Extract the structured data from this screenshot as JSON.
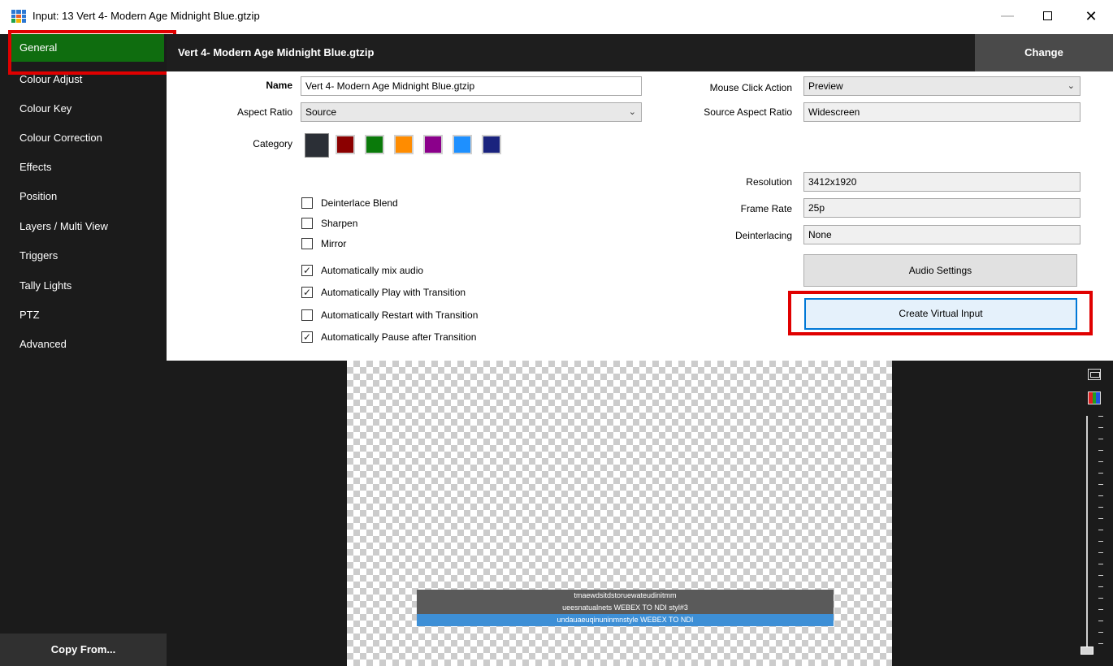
{
  "window": {
    "title": "Input: 13 Vert 4- Modern Age Midnight Blue.gtzip",
    "minimize_label": "—",
    "close_label": "✕",
    "app_icon_colors": [
      "#2c78d3",
      "#2c78d3",
      "#2c78d3",
      "#2c78d3",
      "#e85d2a",
      "#2c78d3",
      "#1fa24a",
      "#f0b400",
      "#2c78d3"
    ]
  },
  "sidebar": {
    "items": [
      {
        "label": "General",
        "active": true
      },
      {
        "label": "Colour Adjust"
      },
      {
        "label": "Colour Key"
      },
      {
        "label": "Colour Correction"
      },
      {
        "label": "Effects"
      },
      {
        "label": "Position"
      },
      {
        "label": "Layers / Multi View"
      },
      {
        "label": "Triggers"
      },
      {
        "label": "Tally Lights"
      },
      {
        "label": "PTZ"
      },
      {
        "label": "Advanced"
      }
    ],
    "copy_from_label": "Copy From..."
  },
  "header": {
    "input_name": "Vert 4- Modern Age Midnight Blue.gtzip",
    "change_label": "Change"
  },
  "form": {
    "name_label": "Name",
    "name_value": "Vert 4- Modern Age Midnight Blue.gtzip",
    "aspect_ratio_label": "Aspect Ratio",
    "aspect_ratio_value": "Source",
    "category_label": "Category",
    "category_colors": [
      "#2b2f36",
      "#8b0000",
      "#0a7a0a",
      "#ff8c00",
      "#8b008b",
      "#1e90ff",
      "#1a237e"
    ],
    "mouse_click_label": "Mouse Click Action",
    "mouse_click_value": "Preview",
    "source_aspect_label": "Source Aspect Ratio",
    "source_aspect_value": "Widescreen",
    "resolution_label": "Resolution",
    "resolution_value": "3412x1920",
    "frame_rate_label": "Frame Rate",
    "frame_rate_value": "25p",
    "deinterlacing_label": "Deinterlacing",
    "deinterlacing_value": "None",
    "audio_settings_label": "Audio Settings",
    "create_virtual_label": "Create Virtual Input",
    "checkboxes": [
      {
        "label": "Deinterlace Blend",
        "checked": false
      },
      {
        "label": "Sharpen",
        "checked": false
      },
      {
        "label": "Mirror",
        "checked": false
      },
      {
        "label": "Automatically mix audio",
        "checked": true
      },
      {
        "label": "Automatically Play with Transition",
        "checked": true
      },
      {
        "label": "Automatically Restart with Transition",
        "checked": false
      },
      {
        "label": "Automatically Pause after Transition",
        "checked": true
      }
    ]
  },
  "preview": {
    "lower_third": [
      "tmaewdsitdstoruewateudinitmm",
      "ueesnatualnets WEBEX TO NDI styl#3",
      "undauaeuqinuninmnstyle WEBEX TO NDI"
    ]
  },
  "colors": {
    "active_tab": "#0f6d0f",
    "highlight": "#e00000",
    "focus_border": "#0078d7"
  }
}
